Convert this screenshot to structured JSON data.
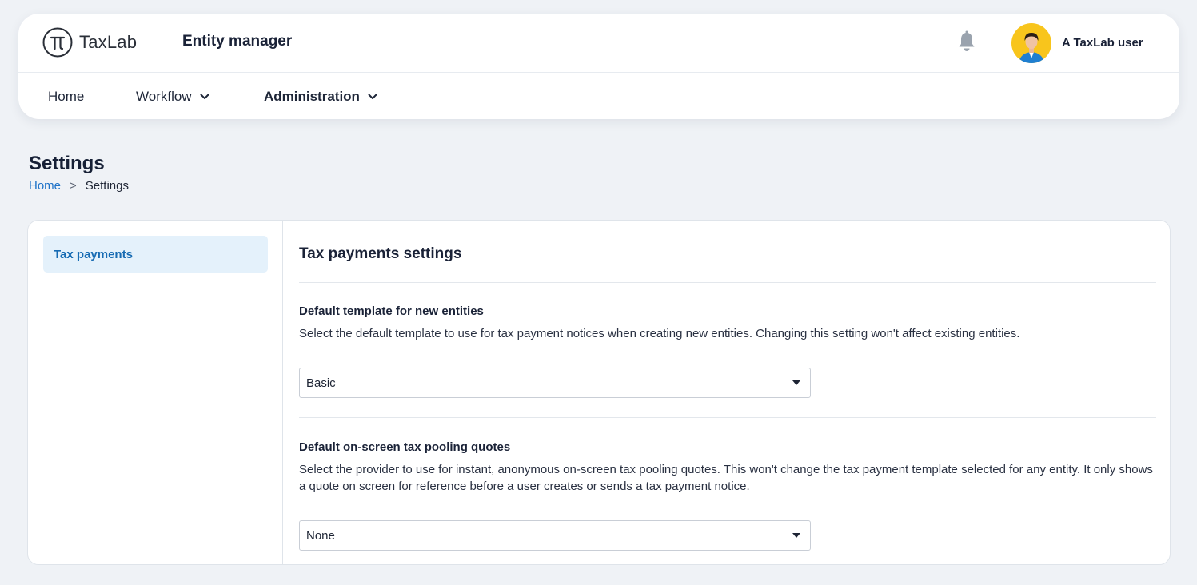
{
  "header": {
    "logo_text": "TaxLab",
    "app_title": "Entity manager",
    "user_name": "A TaxLab user",
    "icons": {
      "logo": "pi-logo-icon",
      "bell": "bell-icon",
      "avatar": "user-avatar-icon"
    }
  },
  "nav": {
    "items": [
      {
        "label": "Home",
        "has_dropdown": false,
        "active": false
      },
      {
        "label": "Workflow",
        "has_dropdown": true,
        "active": false
      },
      {
        "label": "Administration",
        "has_dropdown": true,
        "active": true
      }
    ]
  },
  "page": {
    "title": "Settings",
    "breadcrumb": {
      "home": "Home",
      "separator": ">",
      "current": "Settings"
    }
  },
  "sidebar": {
    "items": [
      {
        "label": "Tax payments",
        "selected": true
      }
    ]
  },
  "content": {
    "title": "Tax payments settings",
    "template_setting": {
      "label": "Default template for new entities",
      "help": "Select the default template to use for tax payment notices when creating new entities. Changing this setting won't affect existing entities.",
      "value": "Basic"
    },
    "pooling_setting": {
      "label": "Default on-screen tax pooling quotes",
      "help": "Select the provider to use for instant, anonymous on-screen tax pooling quotes. This won't change the tax payment template selected for any entity. It only shows a quote on screen for reference before a user creates or sends a tax payment notice.",
      "value": "None"
    }
  },
  "colors": {
    "accent": "#1e72c8",
    "sidebar_selected_bg": "#e4f1fb",
    "avatar_bg": "#f8c51c",
    "page_bg": "#eff2f6"
  }
}
